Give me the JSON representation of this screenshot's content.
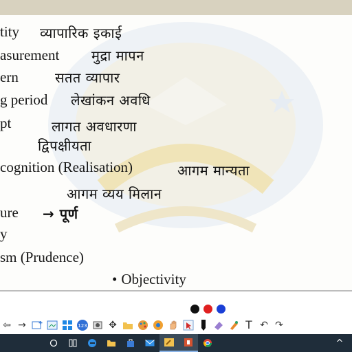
{
  "slide": {
    "lines": [
      {
        "typed": "tity",
        "hand": "व्यापारिक इकाई"
      },
      {
        "typed": "asurement",
        "hand": "मुद्रा मापन"
      },
      {
        "typed": "ern",
        "hand": "सतत व्यापार"
      },
      {
        "typed": "g period",
        "hand": "लेखांकन अवधि"
      },
      {
        "typed": "pt",
        "hand": "लागत अवधारणा"
      },
      {
        "typed": "",
        "hand": "द्विपक्षीयता"
      },
      {
        "typed": "cognition (Realisation)",
        "hand": "आगम मान्यता"
      },
      {
        "typed": "",
        "hand": "आगम व्यय मिलान"
      },
      {
        "typed": "ure",
        "hand": "→ पूर्ण"
      },
      {
        "typed": "y",
        "hand": ""
      },
      {
        "typed": "sm (Prudence)",
        "hand": ""
      }
    ],
    "bullet": "Objectivity"
  },
  "colors": {
    "pen_black": "#111111",
    "pen_red": "#e02020",
    "pen_blue": "#1a3fd6",
    "taskbar": "#1f2d3a"
  },
  "toolbar": {
    "tools": [
      "arrow-left-icon",
      "arrow-right-icon",
      "add-slide-icon",
      "screenshot-icon",
      "windows-icon",
      "zoom-icon",
      "capture-icon",
      "move-icon",
      "folder-icon",
      "palette-icon",
      "browser-icon",
      "hand-icon",
      "pointer-icon",
      "marker-icon",
      "eraser-icon",
      "highlighter-icon",
      "text-icon",
      "undo-icon",
      "redo-icon"
    ],
    "text_tool_label": "T"
  },
  "taskbar": {
    "items": [
      "search-icon",
      "task-view-icon",
      "edge-icon",
      "file-explorer-icon",
      "store-icon",
      "mail-icon",
      "whiteboard-app-icon",
      "powerpoint-icon",
      "chrome-icon"
    ]
  }
}
